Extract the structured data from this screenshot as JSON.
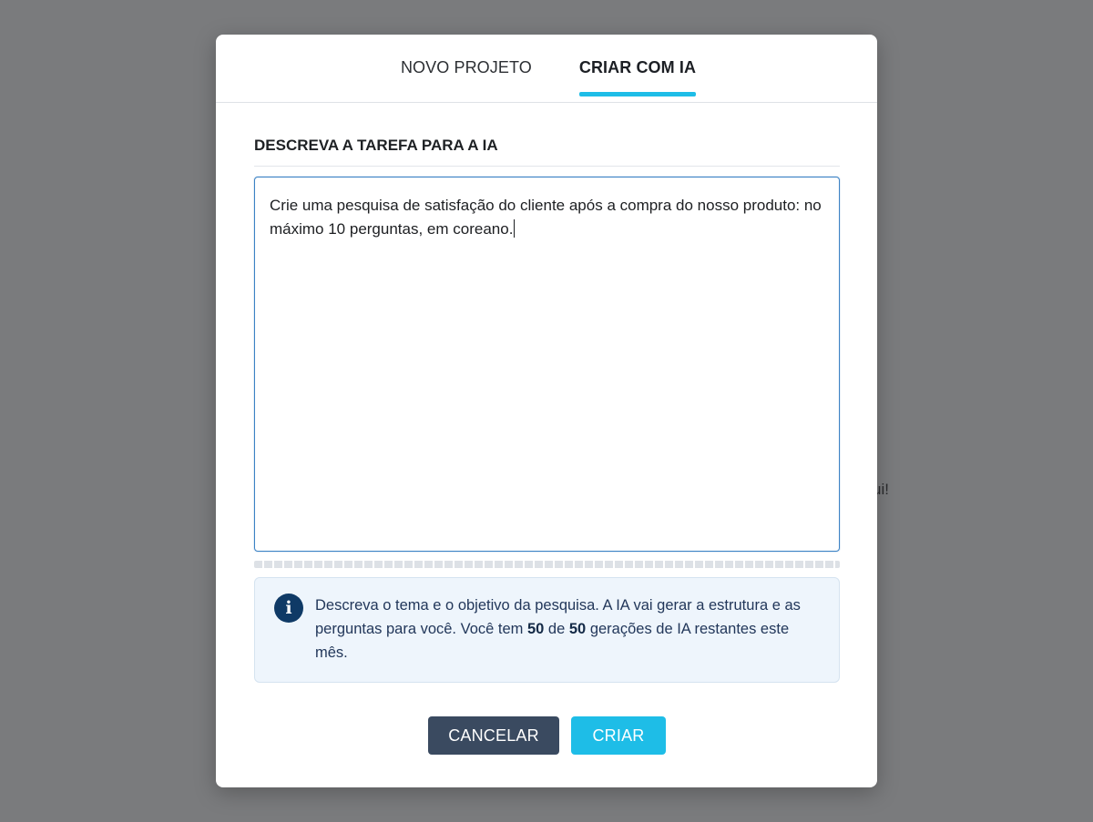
{
  "background": {
    "partial_text": "ui!"
  },
  "tabs": [
    {
      "label": "NOVO PROJETO",
      "active": false
    },
    {
      "label": "CRIAR COM IA",
      "active": true
    }
  ],
  "form": {
    "section_title": "DESCREVA A TAREFA PARA A IA",
    "task_text": "Crie uma pesquisa de satisfação do cliente após a compra do nosso produto: no máximo 10 perguntas, em coreano."
  },
  "info": {
    "icon": "info-icon",
    "text_before": "Descreva o tema e o objetivo da pesquisa. A IA vai gerar a estrutura e as perguntas para você. Você tem ",
    "remaining": "50",
    "text_middle": " de ",
    "total": "50",
    "text_after": " gerações de IA restantes este mês."
  },
  "actions": {
    "cancel_label": "CANCELAR",
    "create_label": "CRIAR"
  },
  "colors": {
    "accent": "#1ebde7",
    "cancel_button": "#3a4a60",
    "overlay": "#7a7b7d",
    "info_bg": "#eef5fc"
  }
}
